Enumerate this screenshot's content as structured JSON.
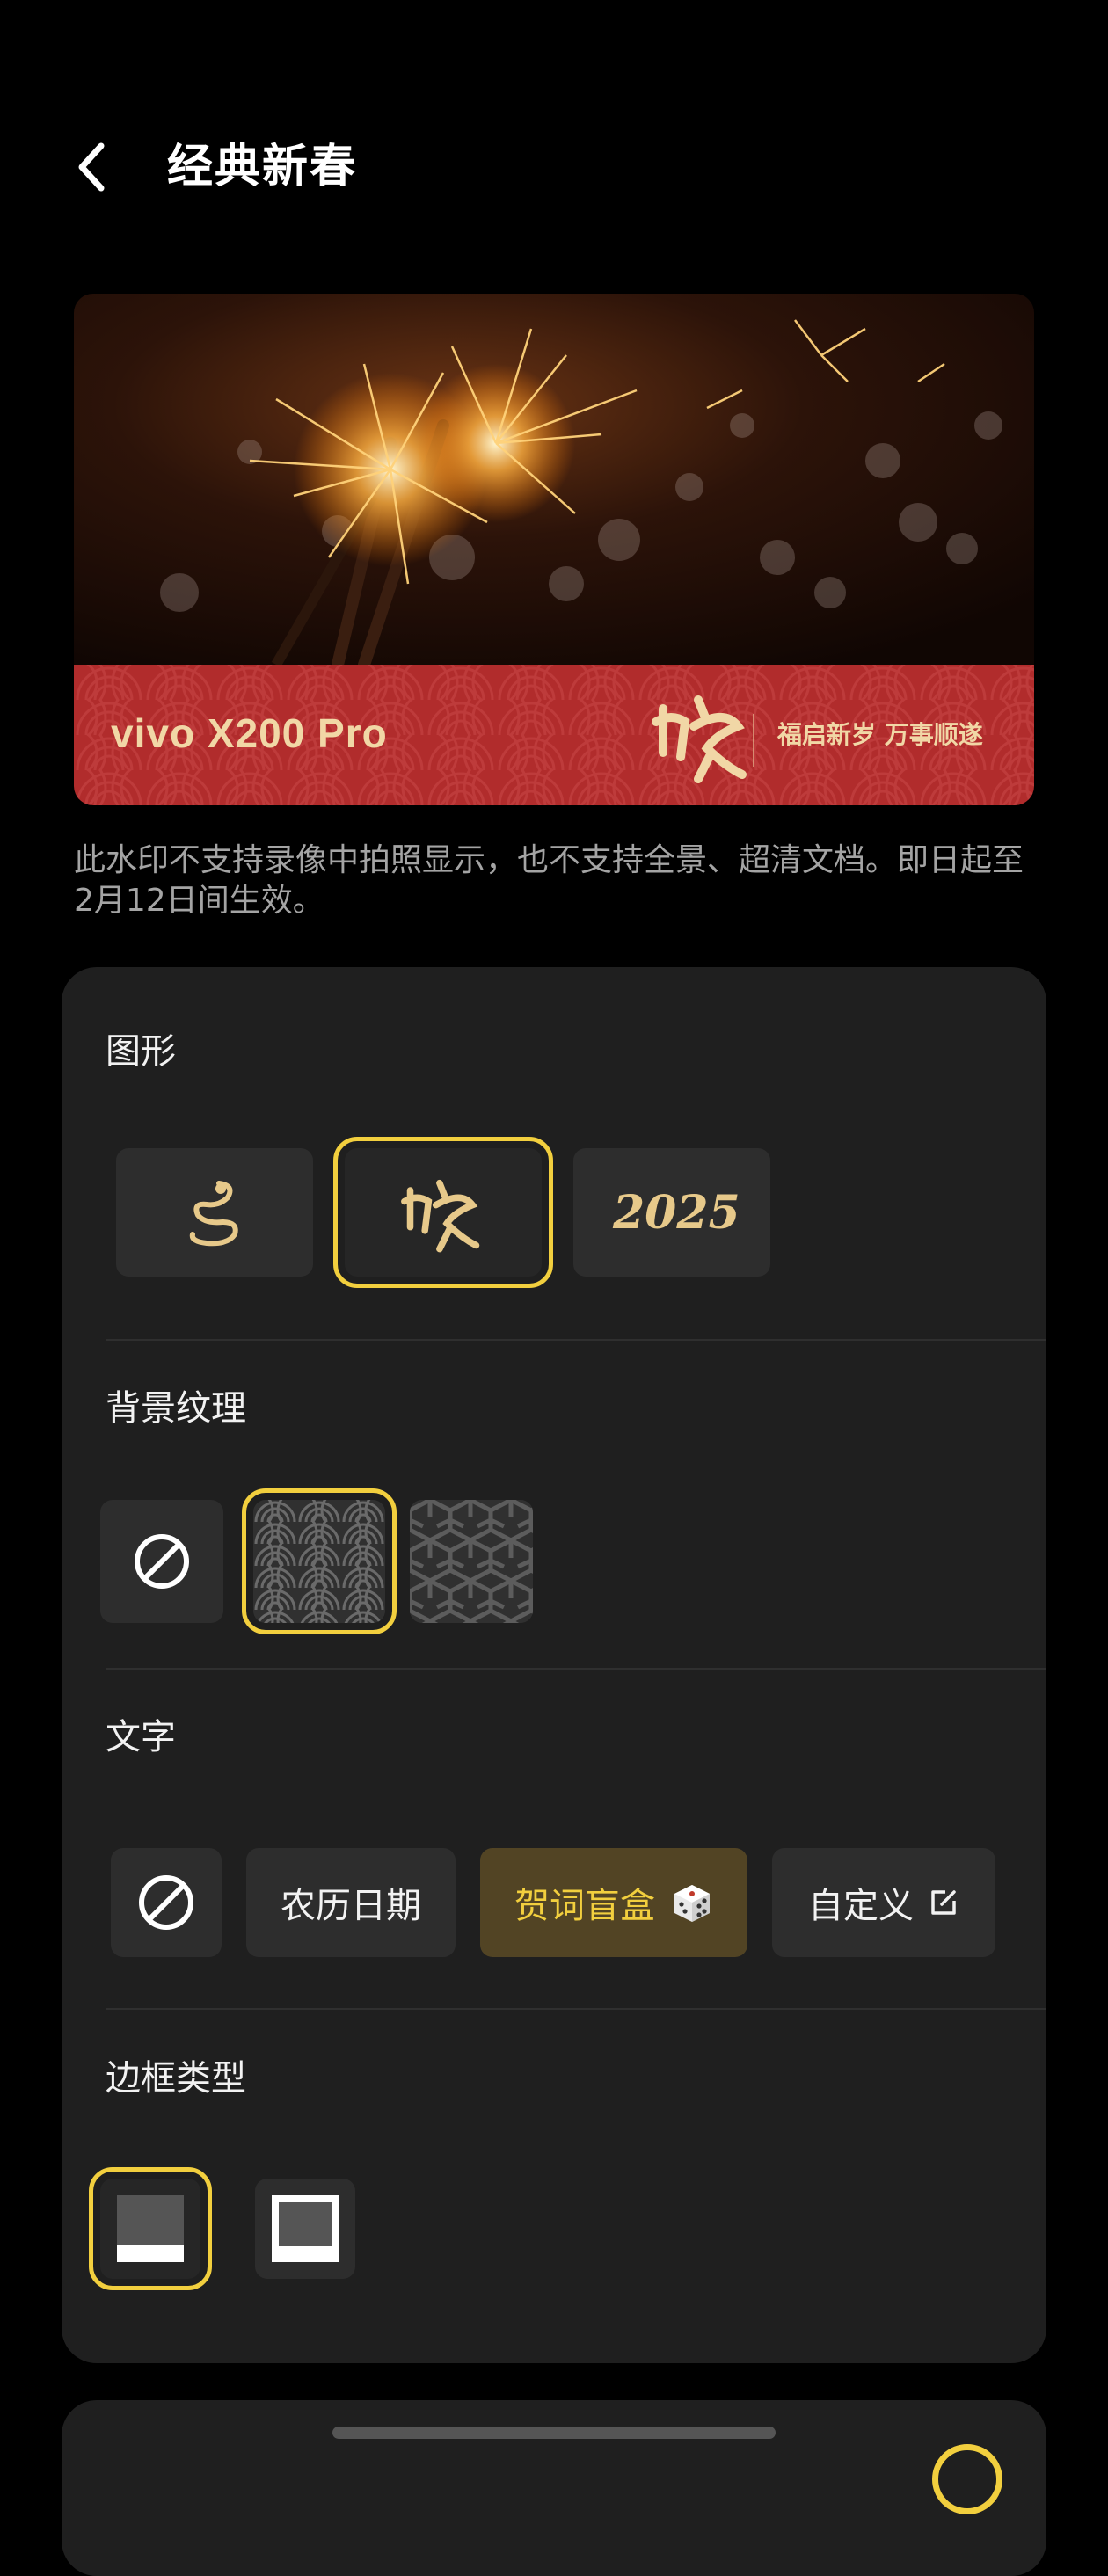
{
  "header": {
    "title": "经典新春",
    "back_icon": "chevron-left-icon"
  },
  "preview": {
    "brand": "vivo X200 Pro",
    "logo_icon": "snake-calligraphy-icon",
    "slogan": "福启新岁 万事顺遂",
    "band_color": "#b12c2c",
    "text_color": "#f1d7a6"
  },
  "notice": "此水印不支持录像中拍照显示，也不支持全景、超清文档。即日起至2月12日间生效。",
  "sections": {
    "graphic": {
      "title": "图形",
      "options": [
        "snake-line-icon",
        "snake-calligraphy-icon",
        "2025-calligraphy-icon"
      ],
      "selected_index": 1
    },
    "texture": {
      "title": "背景纹理",
      "options": [
        "none-icon",
        "wave-pattern-icon",
        "geometric-pattern-icon"
      ],
      "selected_index": 1
    },
    "text": {
      "title": "文字",
      "none_icon": "none-icon",
      "lunar_date": "农历日期",
      "blessing_box": "贺词盲盒",
      "blessing_icon": "dice-icon",
      "custom": "自定义",
      "custom_icon": "edit-icon",
      "selected": "贺词盲盒"
    },
    "frame": {
      "title": "边框类型",
      "options": [
        "frame-bottom-icon",
        "frame-full-icon"
      ],
      "selected_index": 0
    }
  },
  "colors": {
    "accent": "#f2cf3e",
    "panel": "#1f1f1f",
    "tile": "#2d2d2d"
  }
}
